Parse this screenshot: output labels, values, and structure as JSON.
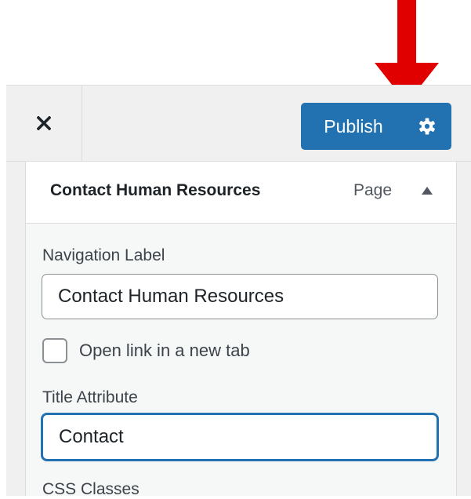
{
  "header": {
    "close_icon": "close-icon",
    "publish_label": "Publish",
    "settings_icon": "gear-icon",
    "accent_color": "#2271b1"
  },
  "annotation": {
    "icon": "red-arrow-icon",
    "color": "#e00000"
  },
  "menu_item": {
    "title": "Contact Human Resources",
    "type": "Page",
    "toggle_icon": "triangle-up-icon"
  },
  "fields": {
    "navigation_label": {
      "label": "Navigation Label",
      "value": "Contact Human Resources"
    },
    "open_new_tab": {
      "label": "Open link in a new tab",
      "checked": false
    },
    "title_attribute": {
      "label": "Title Attribute",
      "value": "Contact"
    },
    "css_classes": {
      "label": "CSS Classes"
    }
  }
}
